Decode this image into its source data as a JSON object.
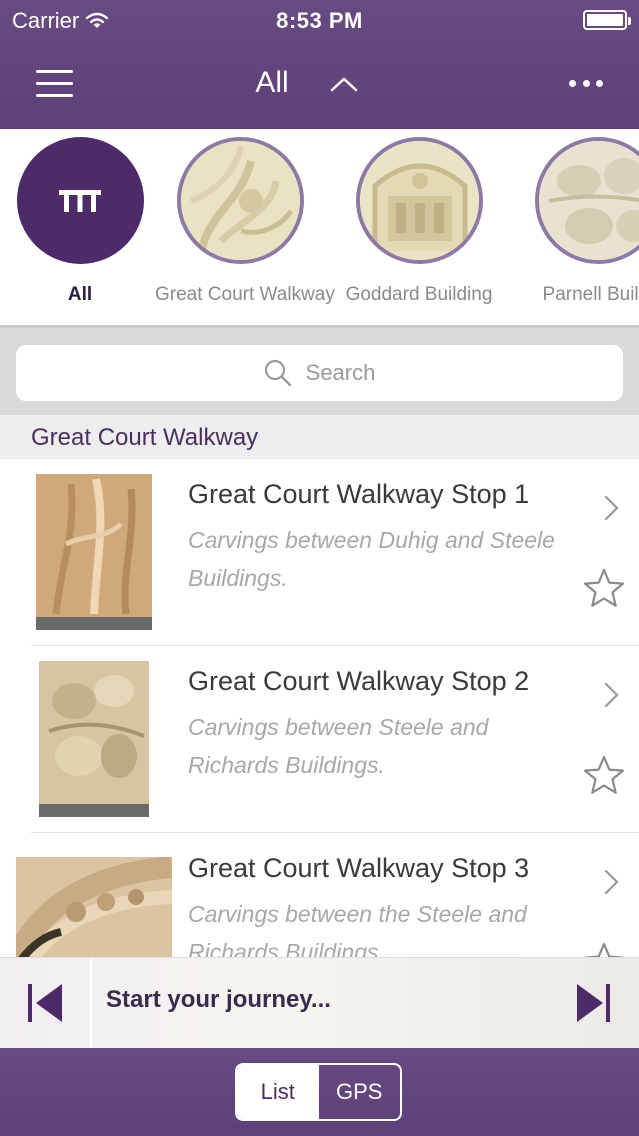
{
  "status_bar": {
    "carrier": "Carrier",
    "time": "8:53 PM"
  },
  "nav": {
    "title": "All"
  },
  "categories": [
    {
      "label": "All",
      "active": true
    },
    {
      "label": "Great Court Walkway",
      "active": false
    },
    {
      "label": "Goddard Building",
      "active": false
    },
    {
      "label": "Parnell Buildi",
      "active": false
    }
  ],
  "search": {
    "placeholder": "Search"
  },
  "section": {
    "title": "Great Court Walkway"
  },
  "stops": [
    {
      "title": "Great Court Walkway Stop 1",
      "description": "Carvings between Duhig and Steele Buildings."
    },
    {
      "title": "Great Court Walkway Stop 2",
      "description": "Carvings between Steele and Richards Buildings."
    },
    {
      "title": "Great Court Walkway Stop 3",
      "description": "Carvings between the Steele and Richards Buildings."
    }
  ],
  "player": {
    "label": "Start your journey..."
  },
  "view_toggle": {
    "list": "List",
    "gps": "GPS",
    "selected": "List"
  },
  "colors": {
    "brand_purple": "#5f3f78",
    "all_circle": "#4d2a6a",
    "accent_text": "#4a2f5e"
  }
}
